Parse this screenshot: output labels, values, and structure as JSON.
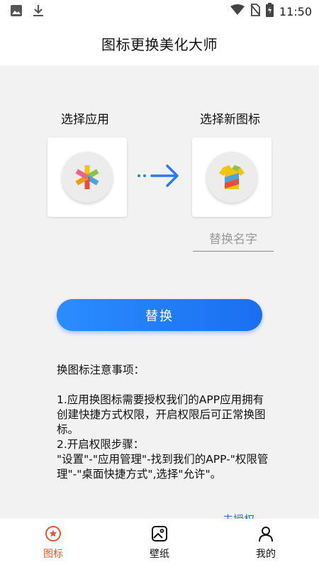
{
  "status_bar": {
    "time": "11:50",
    "icons": [
      "image-icon",
      "download-icon",
      "wifi-icon",
      "no-sim-icon",
      "battery-charging-icon"
    ]
  },
  "header": {
    "title": "图标更换美化大师"
  },
  "main": {
    "select_app_label": "选择应用",
    "select_icon_label": "选择新图标",
    "name_input_placeholder": "替换名字",
    "replace_button_label": "替换",
    "notes": {
      "heading": "换图标注意事项：",
      "lines": [
        "1.应用换图标需要授权我们的APP应用拥有创建快捷方式权限，开启权限后可正常换图标。",
        "2.开启权限步骤：",
        "\"设置\"-\"应用管理\"-找到我们的APP-\"权限管理\"-\"桌面快捷方式\",选择\"允许\"。"
      ]
    },
    "auth_link": "去授权"
  },
  "bottom_nav": {
    "items": [
      {
        "label": "图标",
        "icon": "star-badge-icon",
        "active": true
      },
      {
        "label": "壁纸",
        "icon": "wallpaper-icon",
        "active": false
      },
      {
        "label": "我的",
        "icon": "person-icon",
        "active": false
      }
    ],
    "accent_color": "#e4572e"
  },
  "colors": {
    "button": "#1a6ff0",
    "link": "#2f6cd8"
  }
}
